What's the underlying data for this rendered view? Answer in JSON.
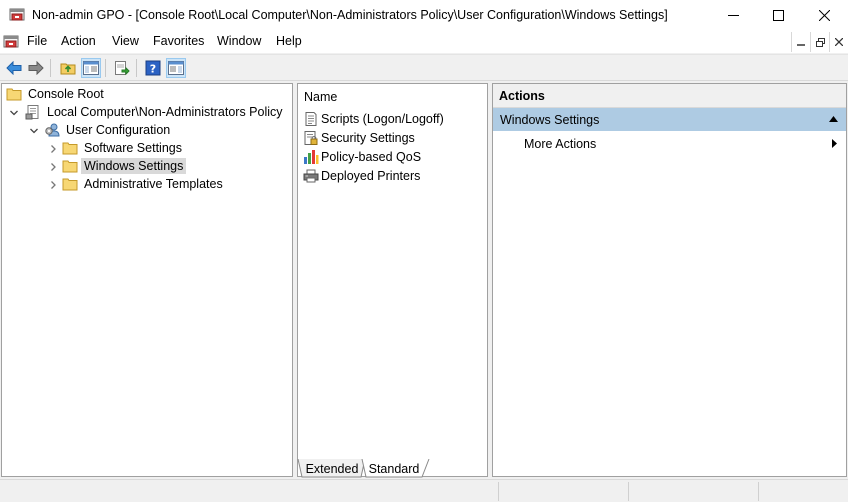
{
  "window": {
    "title": "Non-admin GPO - [Console Root\\Local Computer\\Non-Administrators Policy\\User Configuration\\Windows Settings]"
  },
  "menubar": {
    "items": [
      "File",
      "Action",
      "View",
      "Favorites",
      "Window",
      "Help"
    ]
  },
  "toolbar": {
    "buttons": [
      "back-arrow-icon",
      "forward-arrow-icon",
      "up-folder-icon",
      "show-hide-tree-icon",
      "export-list-icon",
      "help-icon",
      "show-hide-action-pane-icon"
    ]
  },
  "tree": {
    "items": [
      {
        "label": "Console Root",
        "icon": "folder-icon"
      },
      {
        "label": "Local Computer\\Non-Administrators Policy",
        "icon": "policy-document-icon",
        "expanded": true
      },
      {
        "label": "User Configuration",
        "icon": "user-config-icon",
        "expanded": true
      },
      {
        "label": "Software Settings",
        "icon": "folder-icon",
        "expanded": false
      },
      {
        "label": "Windows Settings",
        "icon": "folder-icon",
        "expanded": false,
        "selected": true
      },
      {
        "label": "Administrative Templates",
        "icon": "folder-icon",
        "expanded": false
      }
    ]
  },
  "list": {
    "column_header": "Name",
    "items": [
      {
        "label": "Scripts (Logon/Logoff)",
        "icon": "script-icon"
      },
      {
        "label": "Security Settings",
        "icon": "security-icon"
      },
      {
        "label": "Policy-based QoS",
        "icon": "qos-chart-icon"
      },
      {
        "label": "Deployed Printers",
        "icon": "printer-icon"
      }
    ],
    "tabs": [
      "Extended",
      "Standard"
    ],
    "active_tab": "Standard"
  },
  "actions": {
    "header": "Actions",
    "section_title": "Windows Settings",
    "more_actions": "More Actions"
  },
  "colors": {
    "section_highlight": "#aecbe3",
    "selected_tree_item": "#d9d9d9",
    "toolbar_pressed": "#cce4f7"
  }
}
